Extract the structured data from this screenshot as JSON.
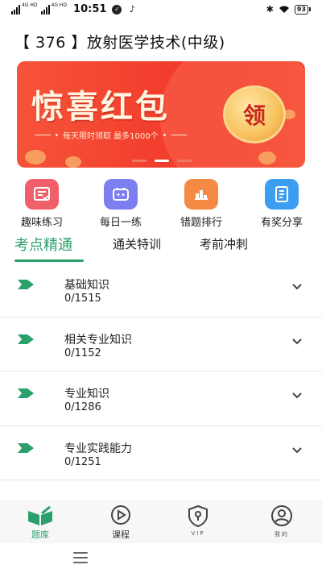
{
  "status_bar": {
    "network_1": "4G HD",
    "network_2": "4G HD",
    "time": "10:51",
    "battery": "93"
  },
  "page": {
    "title": "【 376 】放射医学技术(中级)"
  },
  "banner": {
    "headline": "惊喜红包",
    "subtitle": "每天限时领取  最多1000个",
    "badge": "领",
    "slides_count": 3,
    "active_slide": 2
  },
  "quick_actions": [
    {
      "label": "趣味练习",
      "icon": "fun-practice-icon",
      "color": "#f0606a"
    },
    {
      "label": "每日一练",
      "icon": "daily-practice-icon",
      "color": "#7d7ff0"
    },
    {
      "label": "错题排行",
      "icon": "mistake-ranking-icon",
      "color": "#f58a45"
    },
    {
      "label": "有奖分享",
      "icon": "share-reward-icon",
      "color": "#3b9ef0"
    }
  ],
  "tabs": [
    {
      "label": "考点精通",
      "active": true
    },
    {
      "label": "通关特训",
      "active": false
    },
    {
      "label": "考前冲刺",
      "active": false
    }
  ],
  "subjects": [
    {
      "name": "基础知识",
      "progress": "0/1515"
    },
    {
      "name": "相关专业知识",
      "progress": "0/1152"
    },
    {
      "name": "专业知识",
      "progress": "0/1286"
    },
    {
      "name": "专业实践能力",
      "progress": "0/1251"
    }
  ],
  "bottom_nav": [
    {
      "label": "题库",
      "active": true
    },
    {
      "label": "课程",
      "active": false
    },
    {
      "label": "VIP",
      "active": false
    },
    {
      "label": "我的",
      "active": false
    }
  ],
  "colors": {
    "accent": "#2ca06c",
    "banner_red": "#f23a2a"
  }
}
